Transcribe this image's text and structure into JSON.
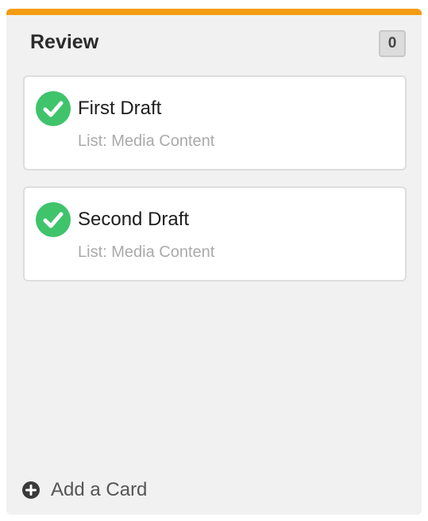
{
  "column": {
    "title": "Review",
    "count": "0",
    "accent_color": "#f39c12"
  },
  "cards": [
    {
      "title": "First Draft",
      "subtitle": "List: Media Content",
      "icon": "check-circle-icon",
      "status_color": "#3fc36b"
    },
    {
      "title": "Second Draft",
      "subtitle": "List: Media Content",
      "icon": "check-circle-icon",
      "status_color": "#3fc36b"
    }
  ],
  "footer": {
    "add_card_label": "Add a Card",
    "icon": "plus-circle-icon"
  }
}
